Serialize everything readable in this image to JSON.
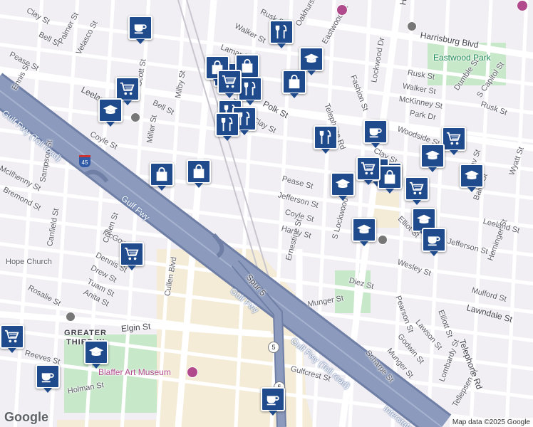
{
  "map": {
    "attribution": "Map data ©2025 Google",
    "logo": "Google",
    "colors": {
      "background": "#f1eff3",
      "street": "#ffffff",
      "freeway": "#8c9bbd",
      "freeway_edge": "#6f7fa6",
      "park": "#c7e8c9",
      "campus": "#f4ecd6",
      "marker": "#1f4a8c",
      "poi": "#b04a8c"
    },
    "streets": [
      "Clay St",
      "Rusk St",
      "Walker St",
      "Lamar St",
      "Oakhurst St",
      "Eastwood St",
      "Harrisburg Blvd",
      "Bell St",
      "Palmer St",
      "Velasco St",
      "Pease St",
      "Ennis St",
      "Scott St",
      "Leeland St",
      "Milby St",
      "Polk St",
      "Telephone Rd",
      "Fashion St",
      "Lockwood Dr",
      "Rusk St",
      "Walker St",
      "McKinney St",
      "Park Dr",
      "Woodside St",
      "Dumble St",
      "S Capitol St",
      "Rusk St",
      "Bell St",
      "Clay St",
      "Coyle St",
      "Miller St",
      "Sampson St",
      "McIlhenny St",
      "Bremond St",
      "Dennis St",
      "McGowen St",
      "Drew St",
      "Tuam St",
      "Anita St",
      "Rosalie St",
      "Canfield St",
      "Caroline St",
      "Cullen Blvd",
      "Jefferson St",
      "Coyle St",
      "Harby St",
      "Ernestine St",
      "S Lockwood Dr",
      "Elliot St",
      "Wesley St",
      "Gustav St",
      "Baird St",
      "Leeland St",
      "Jefferson St",
      "Heminger St",
      "Wyatt St",
      "Diez St",
      "Pearson St",
      "Munger St",
      "Mulford St",
      "Lawndale St",
      "Lawson St",
      "Godwin St",
      "Munger St",
      "Scharpe St",
      "Elliott St",
      "Lombardy St",
      "Tellepsen St",
      "Telephone Rd",
      "Gulfcrest St",
      "Elgin St",
      "Reeves St",
      "Holman St",
      "Spur 5",
      "Interstate 45",
      "Hager St",
      "Cullen St",
      "Clay St",
      "Pease St"
    ],
    "freeway_labels": [
      "Gulf Fwy (Toll road)",
      "Gulf Fwy",
      "Gulf Fwy",
      "Gulf Fwy (Toll road)",
      "Interstate 45"
    ],
    "areas": [
      "GREATER THIRD W",
      "Hope Church",
      "Blaffer Art Museum",
      "Eastwood Park"
    ],
    "shields": [
      "45",
      "5",
      "5"
    ],
    "markers": [
      {
        "icon": "coffee-icon",
        "category": "cafe"
      },
      {
        "icon": "restaurant-icon",
        "category": "restaurant"
      },
      {
        "icon": "school-icon",
        "category": "school"
      },
      {
        "icon": "shopping-cart-icon",
        "category": "grocery"
      },
      {
        "icon": "shopping-cart-icon",
        "category": "grocery"
      },
      {
        "icon": "shopping-bag-icon",
        "category": "store"
      },
      {
        "icon": "shopping-bag-icon",
        "category": "store"
      },
      {
        "icon": "restaurant-icon",
        "category": "restaurant"
      },
      {
        "icon": "shopping-bag-icon",
        "category": "store"
      },
      {
        "icon": "shopping-cart-icon",
        "category": "grocery"
      },
      {
        "icon": "school-icon",
        "category": "school"
      },
      {
        "icon": "restaurant-icon",
        "category": "restaurant"
      },
      {
        "icon": "restaurant-icon",
        "category": "restaurant"
      },
      {
        "icon": "restaurant-icon",
        "category": "restaurant"
      },
      {
        "icon": "restaurant-icon",
        "category": "restaurant"
      },
      {
        "icon": "shopping-cart-icon",
        "category": "grocery"
      },
      {
        "icon": "school-icon",
        "category": "school"
      },
      {
        "icon": "school-icon",
        "category": "school"
      },
      {
        "icon": "shopping-bag-icon",
        "category": "store"
      },
      {
        "icon": "shopping-bag-icon",
        "category": "store"
      },
      {
        "icon": "coffee-icon",
        "category": "cafe"
      },
      {
        "icon": "shopping-bag-icon",
        "category": "store"
      },
      {
        "icon": "shopping-cart-icon",
        "category": "grocery"
      },
      {
        "icon": "school-icon",
        "category": "school"
      },
      {
        "icon": "school-icon",
        "category": "school"
      },
      {
        "icon": "shopping-bag-icon",
        "category": "store"
      },
      {
        "icon": "shopping-cart-icon",
        "category": "grocery"
      },
      {
        "icon": "school-icon",
        "category": "school"
      },
      {
        "icon": "school-icon",
        "category": "school"
      },
      {
        "icon": "coffee-icon",
        "category": "cafe"
      },
      {
        "icon": "shopping-cart-icon",
        "category": "grocery"
      },
      {
        "icon": "school-icon",
        "category": "school"
      },
      {
        "icon": "coffee-icon",
        "category": "cafe"
      },
      {
        "icon": "coffee-icon",
        "category": "cafe"
      },
      {
        "icon": "shopping-cart-icon",
        "category": "grocery"
      }
    ]
  }
}
